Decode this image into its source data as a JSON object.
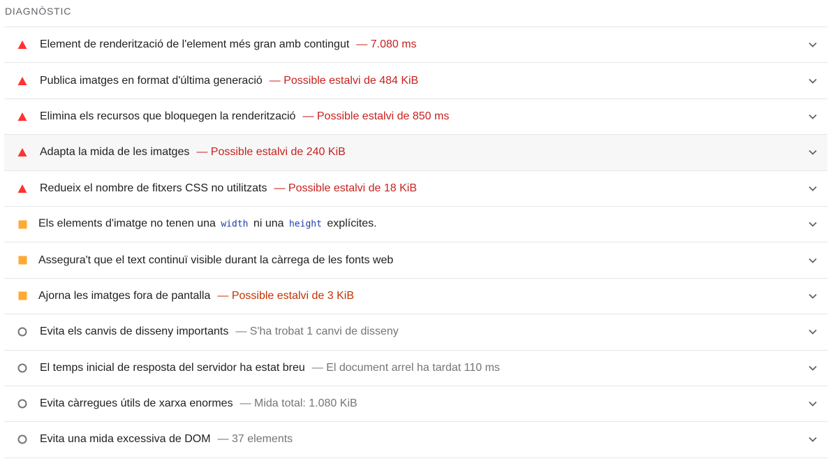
{
  "section": {
    "title": "DIAGNÒSTIC"
  },
  "audits": [
    {
      "status": "fail",
      "icon": "red-triangle-icon",
      "title": "Element de renderització de l'element més gran amb contingut",
      "detail": "— 7.080 ms"
    },
    {
      "status": "fail",
      "icon": "red-triangle-icon",
      "title": "Publica imatges en format d'última generació",
      "detail": "— Possible estalvi de 484 KiB"
    },
    {
      "status": "fail",
      "icon": "red-triangle-icon",
      "title": "Elimina els recursos que bloquegen la renderització",
      "detail": "— Possible estalvi de 850 ms"
    },
    {
      "status": "fail",
      "icon": "red-triangle-icon",
      "title": "Adapta la mida de les imatges",
      "detail": "— Possible estalvi de 240 KiB",
      "hovered": true
    },
    {
      "status": "fail",
      "icon": "red-triangle-icon",
      "title": "Redueix el nombre de fitxers CSS no utilitzats",
      "detail": "— Possible estalvi de 18 KiB"
    },
    {
      "status": "average",
      "icon": "orange-square-icon",
      "title_parts": {
        "part1": "Els elements d'imatge no tenen una",
        "code1": "width",
        "part2": "ni una",
        "code2": "height",
        "part3": "explícites."
      }
    },
    {
      "status": "average",
      "icon": "orange-square-icon",
      "title": "Assegura't que el text continuï visible durant la càrrega de les fonts web"
    },
    {
      "status": "average",
      "icon": "orange-square-icon",
      "title": "Ajorna les imatges fora de pantalla",
      "detail": "— Possible estalvi de 3 KiB"
    },
    {
      "status": "info",
      "icon": "grey-circle-icon",
      "title": "Evita els canvis de disseny importants",
      "detail": "— S'ha trobat 1 canvi de disseny"
    },
    {
      "status": "info",
      "icon": "grey-circle-icon",
      "title": "El temps inicial de resposta del servidor ha estat breu",
      "detail": "— El document arrel ha tardat 110 ms"
    },
    {
      "status": "info",
      "icon": "grey-circle-icon",
      "title": "Evita càrregues útils de xarxa enormes",
      "detail": "— Mida total: 1.080 KiB"
    },
    {
      "status": "info",
      "icon": "grey-circle-icon",
      "title": "Evita una mida excessiva de DOM",
      "detail": "— 37 elements"
    }
  ],
  "colors": {
    "fail": "#ff3333",
    "fail_text": "#c7221f",
    "average": "#ffaa33",
    "average_text": "#c33300",
    "info": "#757575",
    "code": "#1a3fa8"
  }
}
